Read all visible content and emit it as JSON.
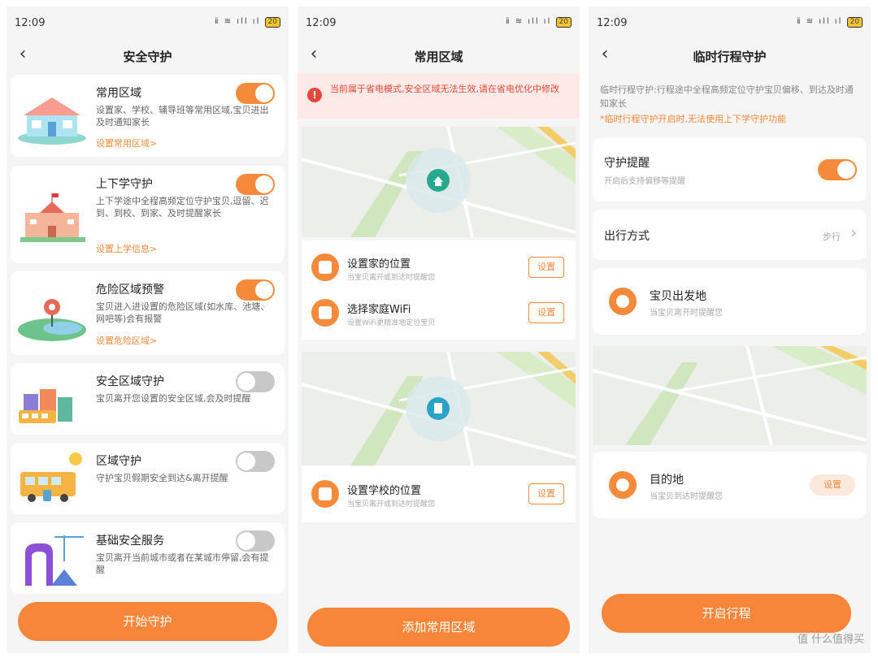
{
  "status_bar": {
    "time": "12:09",
    "signal": "ⅱ ≋ ıll ıl",
    "battery": "20"
  },
  "screen1": {
    "title": "安全守护",
    "features": [
      {
        "title": "常用区域",
        "desc": "设置家、学校、辅导班等常用区域,宝贝进出及时通知家长",
        "link": "设置常用区域>",
        "enabled": true
      },
      {
        "title": "上下学守护",
        "desc": "上下学途中全程高频定位守护宝贝,逗留、迟到、到校、到家、及时提醒家长",
        "link": "设置上学信息>",
        "enabled": true
      },
      {
        "title": "危险区域预警",
        "desc": "宝贝进入进设置的危险区域(如水库、池塘、网吧等)会有报警",
        "link": "设置危险区域>",
        "enabled": true
      },
      {
        "title": "安全区域守护",
        "desc": "宝贝离开您设置的安全区域,会及时提醒",
        "link": "",
        "enabled": false
      },
      {
        "title": "区域守护",
        "desc": "守护宝贝假期安全到达&离开提醒",
        "link": "",
        "enabled": false
      },
      {
        "title": "基础安全服务",
        "desc": "宝贝离开当前城市或者在某城市停留,会有提醒",
        "link": "",
        "enabled": false
      }
    ],
    "start_button": "开始守护"
  },
  "screen2": {
    "title": "常用区域",
    "warning": "当前属于省电模式,安全区域无法生效,请在省电优化中修改",
    "home_title": "设置家的位置",
    "home_sub": "当宝贝离开或到达时提醒您",
    "wifi_title": "选择家庭WiFi",
    "wifi_sub": "设置WiFi更精准地定位宝贝",
    "school_title": "设置学校的位置",
    "school_sub": "当宝贝离开或到达时提醒您",
    "set_label": "设置",
    "add_button": "添加常用区域"
  },
  "screen3": {
    "title": "临时行程守护",
    "intro": "临时行程守护:行程途中全程高频定位守护宝贝偏移、到达及时通知家长",
    "note": "*临时行程守护开启时,无法使用上下学守护功能",
    "reminder_title": "守护提醒",
    "reminder_sub": "开启后支持偏移等提醒",
    "reminder_enabled": true,
    "mode_label": "出行方式",
    "mode_value": "步行",
    "start_place": "宝贝出发地",
    "start_sub": "当宝贝离开时提醒您",
    "dest": "目的地",
    "dest_sub": "当宝贝到达时提醒您",
    "set_label": "设置",
    "start_button": "开启行程"
  },
  "watermark": "值 什么值得买",
  "colors": {
    "accent": "#f58a3a",
    "toggle_off": "#c8c8c8",
    "background": "#f5f5f5"
  }
}
